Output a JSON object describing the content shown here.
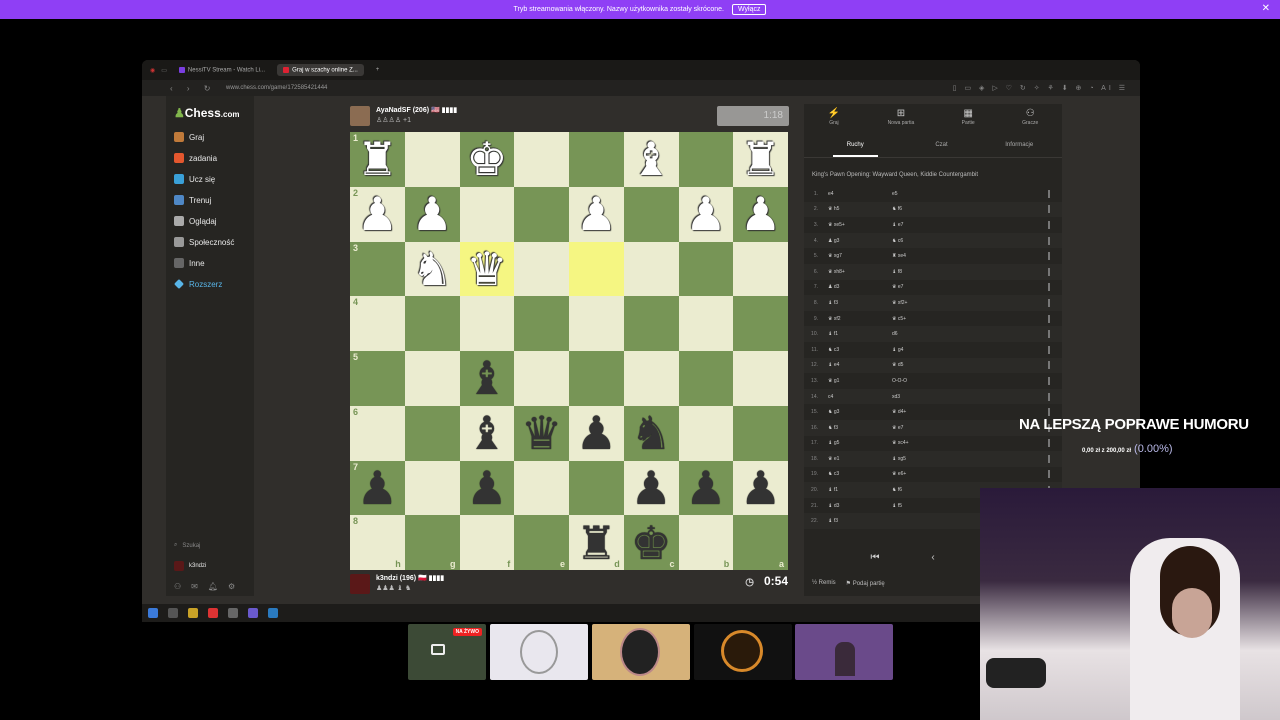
{
  "stream_bar": {
    "message": "Tryb streamowania włączony. Nazwy użytkownika zostały skrócone.",
    "button": "Wyłącz",
    "close": "✕"
  },
  "browser": {
    "tabs": [
      {
        "label": "NessiTV Stream - Watch Li...",
        "active": false
      },
      {
        "label": "Graj w szachy online Z...",
        "active": true
      },
      {
        "label": "+",
        "active": false
      }
    ],
    "url": "www.chess.com/game/172585421444",
    "nav": "‹ › ↻",
    "toolbar_icons": "▯ ▭ ◈ ▷ ♡ ↻ ✧ ⚘ ⬇ ⊕ ◔ AI ☰"
  },
  "sidebar": {
    "logo_a": "Chess",
    "logo_b": ".com",
    "items": [
      "Graj",
      "zadania",
      "Ucz się",
      "Trenuj",
      "Oglądaj",
      "Społeczność",
      "Inne",
      "Rozszerz"
    ],
    "search": "Szukaj",
    "user": "k3ndzi"
  },
  "opponent": {
    "name": "AyaNadSF (206) 🇺🇸 ▮▮▮▮",
    "captured": "♙♙♙♙ +1",
    "clock": "1:18"
  },
  "me": {
    "name": "k3ndzi (196) 🇵🇱 ▮▮▮▮",
    "captured": "♟♟♟ ♝ ♞",
    "timer_icon": "◷",
    "clock": "0:54"
  },
  "board": {
    "orientation": "black",
    "ranks": [
      "1",
      "2",
      "3",
      "4",
      "5",
      "6",
      "7",
      "8"
    ],
    "files": [
      "h",
      "g",
      "f",
      "e",
      "d",
      "c",
      "b",
      "a"
    ],
    "rows": [
      [
        "wR",
        "",
        "wK",
        "",
        "",
        "wB",
        "",
        "wR"
      ],
      [
        "wP",
        "wP",
        "",
        "",
        "wP",
        "",
        "wP",
        "wP"
      ],
      [
        "",
        "wN",
        "wQ",
        "",
        "",
        "",
        "",
        ""
      ],
      [
        "",
        "",
        "",
        "",
        "",
        "",
        "",
        ""
      ],
      [
        "",
        "",
        "bB",
        "",
        "",
        "",
        "",
        ""
      ],
      [
        "",
        "",
        "bB",
        "bQ",
        "bP",
        "bN",
        "",
        ""
      ],
      [
        "bP",
        "",
        "bP",
        "",
        "",
        "bP",
        "bP",
        "bP"
      ],
      [
        "",
        "",
        "",
        "",
        "bR",
        "bK",
        "",
        ""
      ]
    ],
    "highlight": [
      [
        2,
        2
      ],
      [
        2,
        4
      ]
    ]
  },
  "panel": {
    "top": [
      {
        "icon": "⚡",
        "label": "Graj"
      },
      {
        "icon": "⊞",
        "label": "Nowa partia"
      },
      {
        "icon": "▦",
        "label": "Partie"
      },
      {
        "icon": "⚇",
        "label": "Gracze"
      }
    ],
    "tabs": [
      "Ruchy",
      "Czat",
      "Informacje"
    ],
    "opening": "King's Pawn Opening: Wayward Queen, Kiddie Countergambit",
    "moves": [
      [
        "1.",
        "e4",
        "e5"
      ],
      [
        "2.",
        "♛ h5",
        "♞ f6"
      ],
      [
        "3.",
        "♛ xe5+",
        "♝ e7"
      ],
      [
        "4.",
        "♟ g3",
        "♞ c6"
      ],
      [
        "5.",
        "♛ xg7",
        "♜ xe4"
      ],
      [
        "6.",
        "♛ xh8+",
        "♝ f8"
      ],
      [
        "7.",
        "♟ d3",
        "♛ e7"
      ],
      [
        "8.",
        "♝ f3",
        "♛ xf2+"
      ],
      [
        "9.",
        "♛ xf2",
        "♛ c5+"
      ],
      [
        "10.",
        "♝ f1",
        "d6"
      ],
      [
        "11.",
        "♞ c3",
        "♝ g4"
      ],
      [
        "12.",
        "♝ e4",
        "♛ d5"
      ],
      [
        "13.",
        "♛ g1",
        "O-O-O"
      ],
      [
        "14.",
        "c4",
        "xd3"
      ],
      [
        "15.",
        "♞ g3",
        "♛ d4+"
      ],
      [
        "16.",
        "♞ f3",
        "♛ e7"
      ],
      [
        "17.",
        "♝ g5",
        "♛ xc4+"
      ],
      [
        "18.",
        "♛ e1",
        "♝ xg5"
      ],
      [
        "19.",
        "♞ c3",
        "♛ e6+"
      ],
      [
        "20.",
        "♝ f1",
        "♞ f6"
      ],
      [
        "21.",
        "♝ d3",
        "♝ f5"
      ],
      [
        "22.",
        "♝ f3",
        ""
      ]
    ],
    "controls": [
      "⏮",
      "‹",
      "▶"
    ],
    "footer": [
      "½ Remis",
      "⚑ Podaj partię"
    ]
  },
  "overlay": {
    "banner": "NA LEPSZĄ POPRAWE HUMORU",
    "goal": "0,00 zł  z  200,00 zł",
    "goal_pct": "(0.00%)"
  },
  "live_badge": "NA ŻYWO",
  "colors": {
    "stream_bar": "#8f3ff5",
    "board_light": "#ebecd0",
    "board_dark": "#779556",
    "highlight": "#f5f682",
    "accent": "#81b64c"
  }
}
